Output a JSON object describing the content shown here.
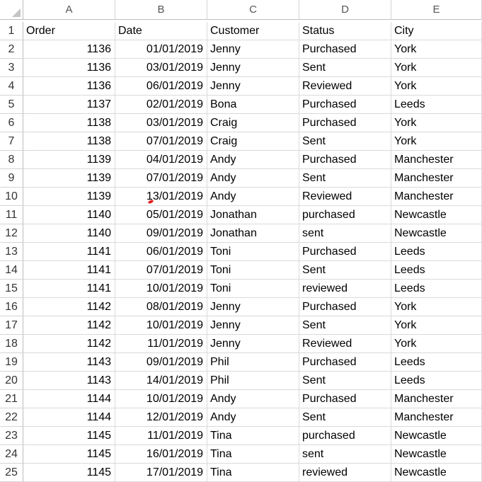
{
  "columns": [
    "A",
    "B",
    "C",
    "D",
    "E"
  ],
  "headers": [
    "Order",
    "Date",
    "Customer",
    "Status",
    "City"
  ],
  "rows": [
    [
      "1136",
      "01/01/2019",
      "Jenny",
      "Purchased",
      "York"
    ],
    [
      "1136",
      "03/01/2019",
      "Jenny",
      "Sent",
      "York"
    ],
    [
      "1136",
      "06/01/2019",
      "Jenny",
      "Reviewed",
      "York"
    ],
    [
      "1137",
      "02/01/2019",
      "Bona",
      "Purchased",
      "Leeds"
    ],
    [
      "1138",
      "03/01/2019",
      "Craig",
      "Purchased",
      "York"
    ],
    [
      "1138",
      "07/01/2019",
      "Craig",
      "Sent",
      "York"
    ],
    [
      "1139",
      "04/01/2019",
      "Andy",
      "Purchased",
      "Manchester"
    ],
    [
      "1139",
      "07/01/2019",
      "Andy",
      "Sent",
      "Manchester"
    ],
    [
      "1139",
      "13/01/2019",
      "Andy",
      "Reviewed",
      "Manchester"
    ],
    [
      "1140",
      "05/01/2019",
      "Jonathan",
      "purchased",
      "Newcastle"
    ],
    [
      "1140",
      "09/01/2019",
      "Jonathan",
      "sent",
      "Newcastle"
    ],
    [
      "1141",
      "06/01/2019",
      "Toni",
      "Purchased",
      "Leeds"
    ],
    [
      "1141",
      "07/01/2019",
      "Toni",
      "Sent",
      "Leeds"
    ],
    [
      "1141",
      "10/01/2019",
      "Toni",
      "reviewed",
      "Leeds"
    ],
    [
      "1142",
      "08/01/2019",
      "Jenny",
      "Purchased",
      "York"
    ],
    [
      "1142",
      "10/01/2019",
      "Jenny",
      "Sent",
      "York"
    ],
    [
      "1142",
      "11/01/2019",
      "Jenny",
      "Reviewed",
      "York"
    ],
    [
      "1143",
      "09/01/2019",
      "Phil",
      "Purchased",
      "Leeds"
    ],
    [
      "1143",
      "14/01/2019",
      "Phil",
      "Sent",
      "Leeds"
    ],
    [
      "1144",
      "10/01/2019",
      "Andy",
      "Purchased",
      "Manchester"
    ],
    [
      "1144",
      "12/01/2019",
      "Andy",
      "Sent",
      "Manchester"
    ],
    [
      "1145",
      "11/01/2019",
      "Tina",
      "purchased",
      "Newcastle"
    ],
    [
      "1145",
      "16/01/2019",
      "Tina",
      "sent",
      "Newcastle"
    ],
    [
      "1145",
      "17/01/2019",
      "Tina",
      "reviewed",
      "Newcastle"
    ]
  ]
}
